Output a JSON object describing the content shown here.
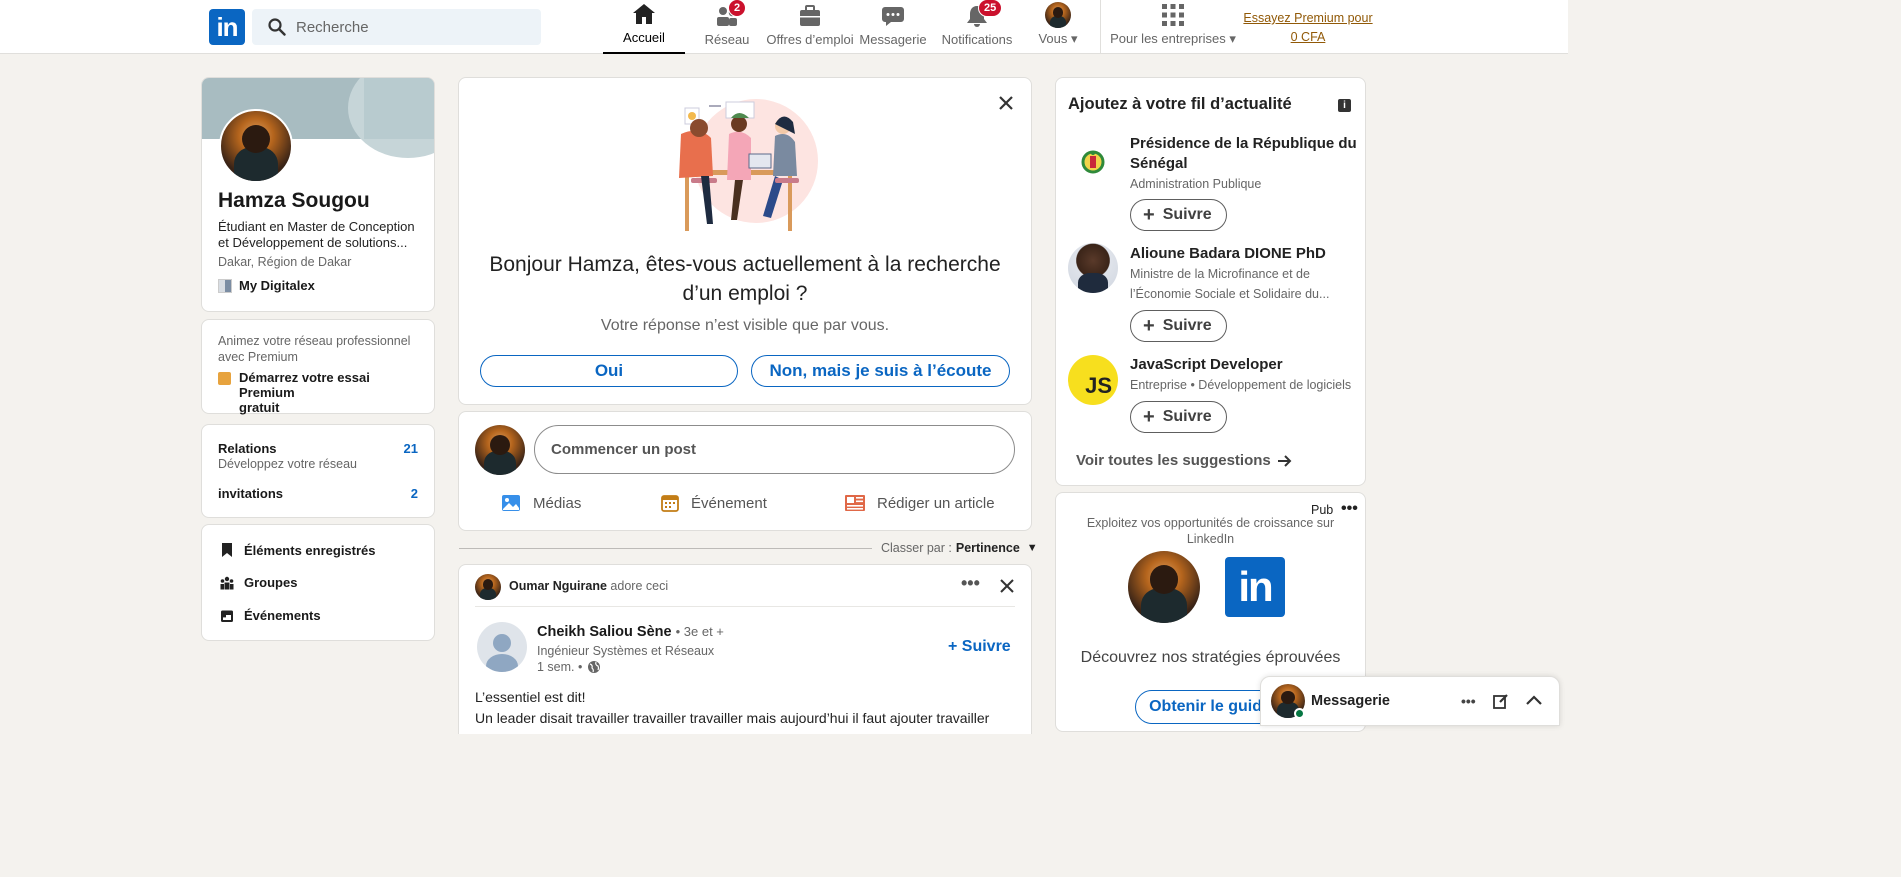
{
  "nav": {
    "search_placeholder": "Recherche",
    "items": [
      {
        "label": "Accueil",
        "icon": "home-icon"
      },
      {
        "label": "Réseau",
        "icon": "network-icon",
        "badge": "2"
      },
      {
        "label": "Offres d’emploi",
        "icon": "briefcase-icon"
      },
      {
        "label": "Messagerie",
        "icon": "message-icon"
      },
      {
        "label": "Notifications",
        "icon": "bell-icon",
        "badge": "25"
      },
      {
        "label": "Vous",
        "icon": "me-avatar"
      },
      {
        "label": "Pour les entreprises",
        "icon": "grid-icon"
      }
    ],
    "premium_line1": "Essayez Premium pour",
    "premium_line2": "0 CFA"
  },
  "profile": {
    "name": "Hamza Sougou",
    "headline_line1": "Étudiant en Master de Conception",
    "headline_line2": "et Développement de solutions...",
    "location": "Dakar, Région de Dakar",
    "company": "My Digitalex"
  },
  "premium_card": {
    "text_line1": "Animez votre réseau professionnel",
    "text_line2": "avec Premium",
    "cta_line1": "Démarrez votre essai Premium",
    "cta_line2": "gratuit"
  },
  "stats": {
    "relations_label": "Relations",
    "relations_count": "21",
    "relations_sub": "Développez votre réseau",
    "invitations_label": "invitations",
    "invitations_count": "2"
  },
  "shortcuts": [
    "Éléments enregistrés",
    "Groupes",
    "Événements"
  ],
  "job_prompt": {
    "title_line1": "Bonjour Hamza, êtes-vous actuellement à la recherche",
    "title_line2": "d’un emploi ?",
    "subtitle": "Votre réponse n’est visible que par vous.",
    "yes": "Oui",
    "no": "Non, mais je suis à l’écoute"
  },
  "composer": {
    "placeholder": "Commencer un post",
    "media": "Médias",
    "event": "Événement",
    "article": "Rédiger un article"
  },
  "sort": {
    "label": "Classer par :",
    "value": "Pertinence"
  },
  "post": {
    "reactor": "Oumar Nguirane",
    "reaction": "adore ceci",
    "author": "Cheikh Saliou Sène",
    "degree": "• 3e et +",
    "author_headline": "Ingénieur Systèmes et Réseaux",
    "time": "1 sem. •",
    "follow": "+ Suivre",
    "body_line1": "L’essentiel est dit!",
    "body_line2": "Un leader disait travailler travailler travailler mais aujourd’hui il faut ajouter travailler"
  },
  "feed_suggest": {
    "title": "Ajoutez à votre fil d’actualité",
    "items": [
      {
        "name_line1": "Présidence de la République du",
        "name_line2": "Sénégal",
        "sub_line1": "Administration Publique",
        "sub_line2": ""
      },
      {
        "name_line1": "Alioune Badara DIONE PhD",
        "name_line2": "",
        "sub_line1": "Ministre de la Microfinance et de",
        "sub_line2": "l’Économie Sociale et Solidaire du..."
      },
      {
        "name_line1": "JavaScript Developer",
        "name_line2": "",
        "sub_line1": "Entreprise • Développement de logiciels",
        "sub_line2": ""
      }
    ],
    "follow_label": "Suivre",
    "see_all": "Voir toutes les suggestions"
  },
  "ad": {
    "tag": "Pub",
    "text_line1": "Exploitez vos opportunités de croissance sur",
    "text_line2": "LinkedIn",
    "headline": "Découvrez nos stratégies éprouvées",
    "cta": "Obtenir le guide",
    "logo_text": "in"
  },
  "messaging": {
    "label": "Messagerie"
  },
  "colors": {
    "brand": "#0a66c2",
    "badge": "#cb112d",
    "premium": "#915907",
    "background": "#f4f2ee"
  }
}
